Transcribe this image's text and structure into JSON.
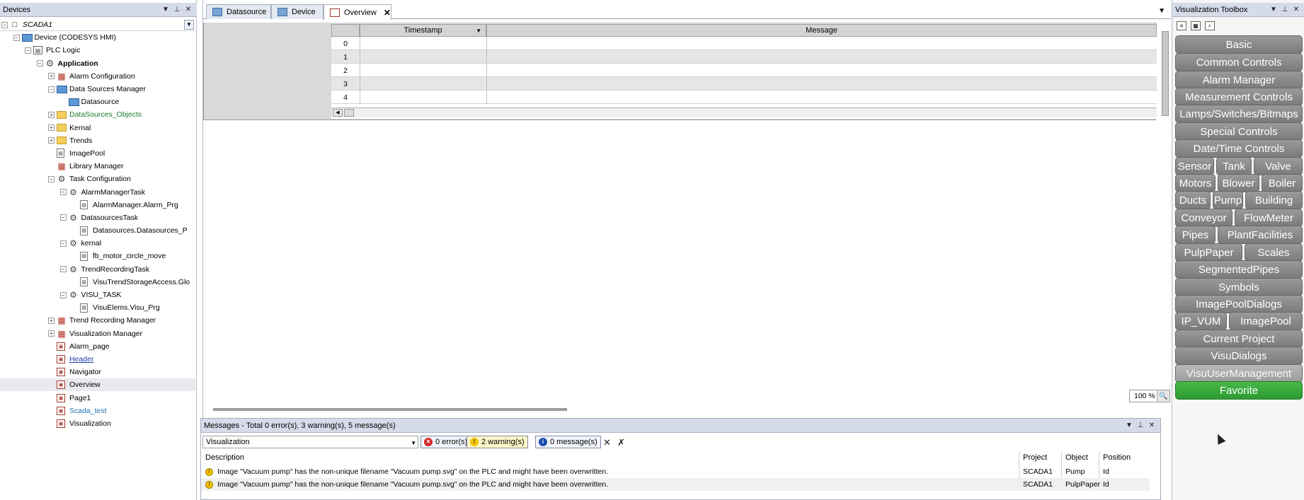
{
  "devices": {
    "title": "Devices",
    "tree": [
      {
        "label": "SCADA1",
        "indent": 0,
        "exp": "-",
        "icon": "project",
        "style": "italic"
      },
      {
        "label": "Device (CODESYS HMI)",
        "indent": 1,
        "exp": "-",
        "icon": "device",
        "style": ""
      },
      {
        "label": "PLC Logic",
        "indent": 2,
        "exp": "-",
        "icon": "plc",
        "style": ""
      },
      {
        "label": "Application",
        "indent": 3,
        "exp": "-",
        "icon": "gear",
        "style": "bold"
      },
      {
        "label": "Alarm Configuration",
        "indent": 4,
        "exp": "+",
        "icon": "red",
        "style": ""
      },
      {
        "label": "Data Sources Manager",
        "indent": 4,
        "exp": "-",
        "icon": "device",
        "style": ""
      },
      {
        "label": "Datasource",
        "indent": 5,
        "exp": "",
        "icon": "device",
        "style": ""
      },
      {
        "label": "DataSources_Objects",
        "indent": 4,
        "exp": "+",
        "icon": "folder",
        "style": "green"
      },
      {
        "label": "Kernal",
        "indent": 4,
        "exp": "+",
        "icon": "folder",
        "style": ""
      },
      {
        "label": "Trends",
        "indent": 4,
        "exp": "+",
        "icon": "folder",
        "style": ""
      },
      {
        "label": "ImagePool",
        "indent": 4,
        "exp": "",
        "icon": "page",
        "style": ""
      },
      {
        "label": "Library Manager",
        "indent": 4,
        "exp": "",
        "icon": "red",
        "style": ""
      },
      {
        "label": "Task Configuration",
        "indent": 4,
        "exp": "-",
        "icon": "task",
        "style": ""
      },
      {
        "label": "AlarmManagerTask",
        "indent": 5,
        "exp": "-",
        "icon": "task",
        "style": ""
      },
      {
        "label": "AlarmManager.Alarm_Prg",
        "indent": 6,
        "exp": "",
        "icon": "page",
        "style": ""
      },
      {
        "label": "DatasourcesTask",
        "indent": 5,
        "exp": "-",
        "icon": "task",
        "style": ""
      },
      {
        "label": "Datasources.Datasources_P",
        "indent": 6,
        "exp": "",
        "icon": "page",
        "style": ""
      },
      {
        "label": "kernal",
        "indent": 5,
        "exp": "-",
        "icon": "task",
        "style": ""
      },
      {
        "label": "fb_motor_circle_move",
        "indent": 6,
        "exp": "",
        "icon": "page",
        "style": ""
      },
      {
        "label": "TrendRecordingTask",
        "indent": 5,
        "exp": "-",
        "icon": "task",
        "style": ""
      },
      {
        "label": "VisuTrendStorageAccess.Glo",
        "indent": 6,
        "exp": "",
        "icon": "page",
        "style": ""
      },
      {
        "label": "VISU_TASK",
        "indent": 5,
        "exp": "-",
        "icon": "task",
        "style": ""
      },
      {
        "label": "VisuElems.Visu_Prg",
        "indent": 6,
        "exp": "",
        "icon": "page",
        "style": ""
      },
      {
        "label": "Trend Recording Manager",
        "indent": 4,
        "exp": "+",
        "icon": "red",
        "style": ""
      },
      {
        "label": "Visualization Manager",
        "indent": 4,
        "exp": "+",
        "icon": "red",
        "style": ""
      },
      {
        "label": "Alarm_page",
        "indent": 4,
        "exp": "",
        "icon": "visu",
        "style": ""
      },
      {
        "label": "Header",
        "indent": 4,
        "exp": "",
        "icon": "visu",
        "style": "link"
      },
      {
        "label": "Navigator",
        "indent": 4,
        "exp": "",
        "icon": "visu",
        "style": ""
      },
      {
        "label": "Overview",
        "indent": 4,
        "exp": "",
        "icon": "visu",
        "style": "",
        "selected": true
      },
      {
        "label": "Page1",
        "indent": 4,
        "exp": "",
        "icon": "visu",
        "style": ""
      },
      {
        "label": "Scada_test",
        "indent": 4,
        "exp": "",
        "icon": "visu",
        "style": "teal"
      },
      {
        "label": "Visualization",
        "indent": 4,
        "exp": "",
        "icon": "visu",
        "style": ""
      }
    ]
  },
  "editor": {
    "tabs": [
      {
        "label": "Datasource",
        "active": false
      },
      {
        "label": "Device",
        "active": false
      },
      {
        "label": "Overview",
        "active": true
      }
    ],
    "alarm_table": {
      "headers": [
        "Timestamp",
        "Message"
      ],
      "rows": [
        "0",
        "1",
        "2",
        "3",
        "4"
      ]
    },
    "zoom": "100 %"
  },
  "messages": {
    "title": "Messages - Total 0 error(s), 3 warning(s), 5 message(s)",
    "filter": "Visualization",
    "errors_label": "0 error(s)",
    "warnings_label": "2 warning(s)",
    "info_label": "0 message(s)",
    "columns": [
      "Description",
      "Project",
      "Object",
      "Position"
    ],
    "rows": [
      {
        "description": "Image \"Vacuum pump\" has the non-unique filename \"Vacuum pump.svg\" on the PLC and might have been overwritten.",
        "project": "SCADA1",
        "object": "Pump",
        "position": "Id"
      },
      {
        "description": "Image \"Vacuum pump\" has the non-unique filename \"Vacuum pump.svg\" on the PLC and might have been overwritten.",
        "project": "SCADA1",
        "object": "PulpPaper",
        "position": "Id"
      }
    ]
  },
  "toolbox": {
    "title": "Visualization Toolbox",
    "categories": [
      [
        "Basic"
      ],
      [
        "Common Controls"
      ],
      [
        "Alarm Manager"
      ],
      [
        "Measurement Controls"
      ],
      [
        "Lamps/Switches/Bitmaps"
      ],
      [
        "Special Controls"
      ],
      [
        "Date/Time Controls"
      ],
      [
        "Sensor",
        "Tank",
        "Valve"
      ],
      [
        "Motors",
        "Blower",
        "Boiler"
      ],
      [
        "Ducts",
        "Pump",
        "Building"
      ],
      [
        "Conveyor",
        "FlowMeter"
      ],
      [
        "Pipes",
        "PlantFacilities"
      ],
      [
        "PulpPaper",
        "Scales"
      ],
      [
        "SegmentedPipes"
      ],
      [
        "Symbols"
      ],
      [
        "ImagePoolDialogs"
      ],
      [
        "IP_VUM",
        "ImagePool"
      ],
      [
        "Current Project"
      ],
      [
        "VisuDialogs"
      ],
      [
        "VisuUserManagement"
      ],
      [
        "Favorite"
      ]
    ]
  }
}
